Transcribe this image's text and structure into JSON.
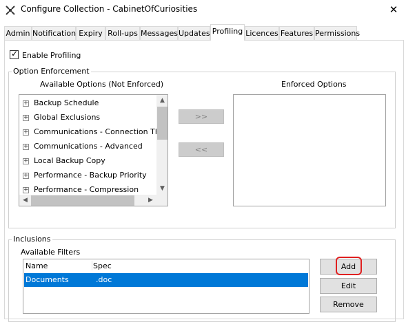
{
  "window": {
    "title": "Configure Collection - CabinetOfCuriosities",
    "close_glyph": "✕"
  },
  "tabs": [
    {
      "label": "Admin"
    },
    {
      "label": "Notification"
    },
    {
      "label": "Expiry"
    },
    {
      "label": "Roll-ups"
    },
    {
      "label": "Messages"
    },
    {
      "label": "Updates"
    },
    {
      "label": "Profiling",
      "active": true
    },
    {
      "label": "Licences"
    },
    {
      "label": "Features"
    },
    {
      "label": "Permissions"
    }
  ],
  "profiling": {
    "enable_label": "Enable Profiling",
    "enable_checked": true,
    "check_glyph": "✓"
  },
  "option_enforcement": {
    "legend": "Option Enforcement",
    "available_header": "Available Options (Not Enforced)",
    "enforced_header": "Enforced Options",
    "expand_glyph": "+",
    "available_options": [
      {
        "label": "Backup Schedule"
      },
      {
        "label": "Global Exclusions"
      },
      {
        "label": "Communications - Connection Throttl"
      },
      {
        "label": "Communications - Advanced"
      },
      {
        "label": "Local Backup Copy"
      },
      {
        "label": "Performance - Backup Priority"
      },
      {
        "label": "Performance - Compression"
      }
    ],
    "move_right_label": ">>",
    "move_left_label": "<<",
    "scroll_up_glyph": "▲",
    "scroll_down_glyph": "▼",
    "scroll_left_glyph": "◀",
    "scroll_right_glyph": "▶"
  },
  "inclusions": {
    "legend": "Inclusions",
    "filters_label": "Available Filters",
    "columns": [
      "Name",
      "Spec"
    ],
    "rows": [
      {
        "name": "Documents",
        "spec": ".doc",
        "selected": true
      }
    ],
    "buttons": {
      "add": "Add",
      "edit": "Edit",
      "remove": "Remove"
    }
  },
  "colors": {
    "selection": "#0078d7",
    "highlight": "#e02020",
    "disabled_button": "#cccccc"
  }
}
